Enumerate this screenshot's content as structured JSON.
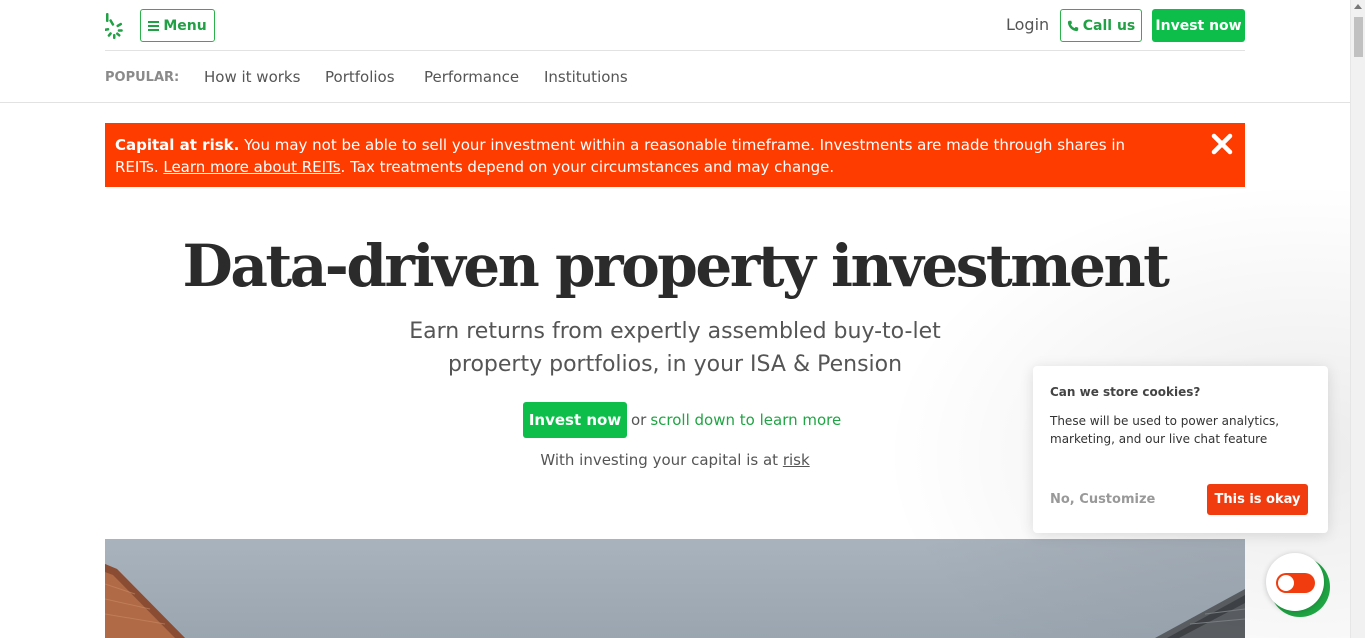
{
  "header": {
    "menu_label": "Menu",
    "login_label": "Login",
    "call_label": "Call us",
    "invest_label": "Invest now"
  },
  "subnav": {
    "popular_label": "POPULAR:",
    "links": [
      "How it works",
      "Portfolios",
      "Performance",
      "Institutions"
    ]
  },
  "risk_banner": {
    "bold_lead": "Capital at risk.",
    "text_before_link": " You may not be able to sell your investment within a reasonable timeframe. Investments are made through shares in REITs. ",
    "link_text": "Learn more about REITs",
    "text_after_link": ". Tax treatments depend on your circumstances and may change."
  },
  "hero": {
    "title": "Data-driven property investment",
    "subtitle": "Earn returns from expertly assembled buy-to-let property portfolios, in your ISA & Pension",
    "invest_label": "Invest now",
    "or_text": "or",
    "scroll_link": "scroll down to learn more",
    "risk_prefix": "With investing your capital is at ",
    "risk_link": "risk"
  },
  "cookie": {
    "title": "Can we store cookies?",
    "body": "These will be used to power analytics, marketing, and our live chat feature",
    "no_label": "No, Customize",
    "ok_label": "This is okay"
  },
  "colors": {
    "brand_green": "#0dbf4a",
    "risk_orange": "#ff3c00",
    "cookie_orange": "#f03c0e"
  }
}
